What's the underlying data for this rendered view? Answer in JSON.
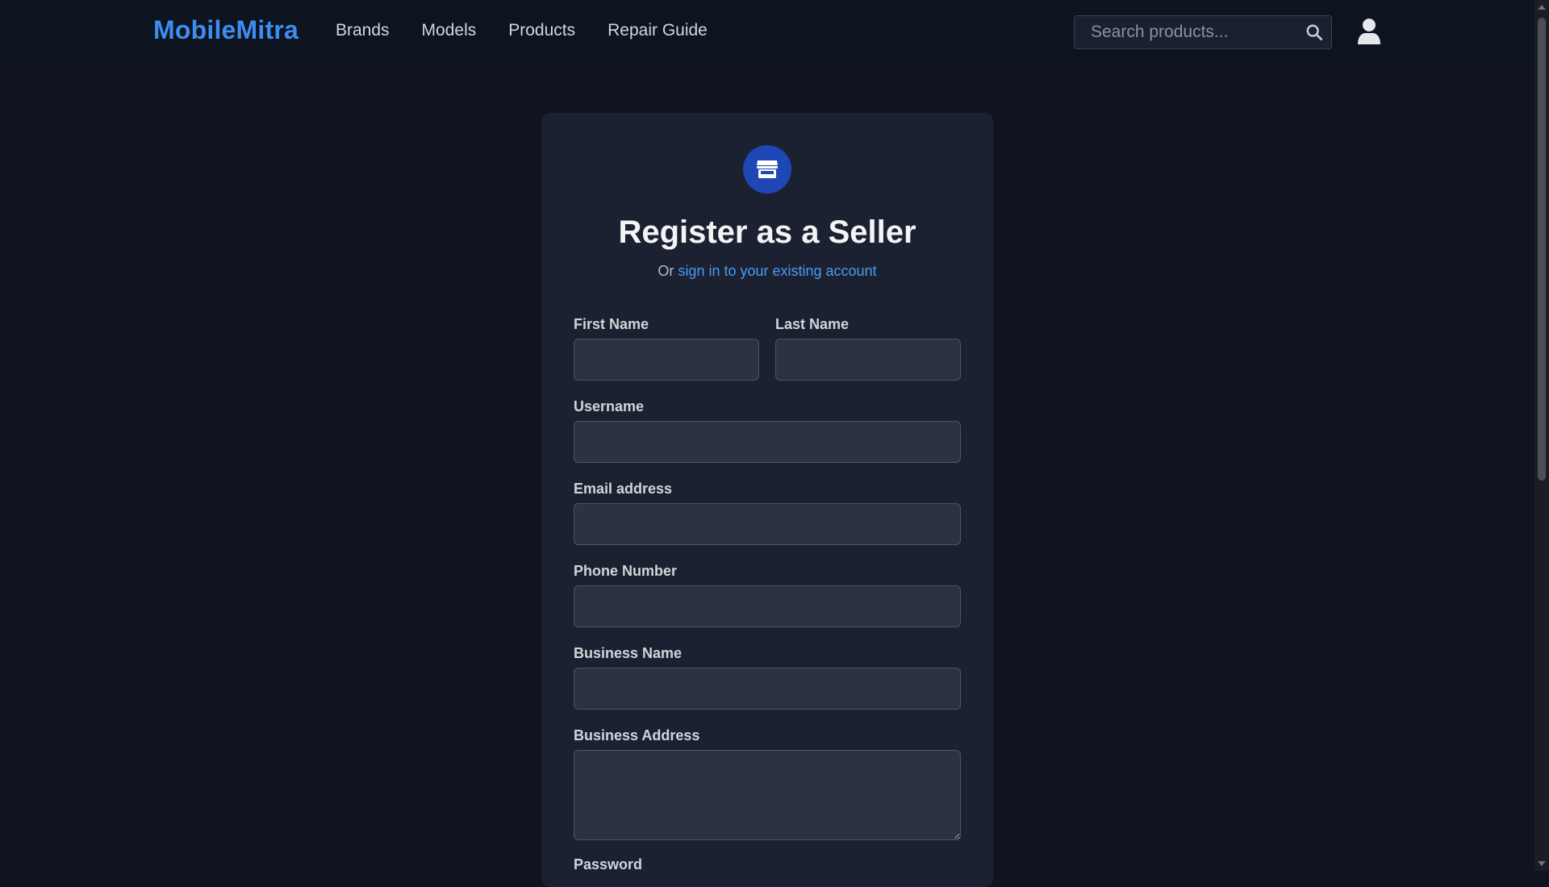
{
  "header": {
    "logo": "MobileMitra",
    "nav": [
      "Brands",
      "Models",
      "Products",
      "Repair Guide"
    ],
    "search_placeholder": "Search products..."
  },
  "form": {
    "title": "Register as a Seller",
    "subtitle_prefix": "Or",
    "signin_link": "sign in to your existing account",
    "fields": {
      "first_name": "First Name",
      "last_name": "Last Name",
      "username": "Username",
      "email": "Email address",
      "phone": "Phone Number",
      "business_name": "Business Name",
      "business_address": "Business Address",
      "password": "Password"
    }
  },
  "colors": {
    "background": "#0f1420",
    "card": "#1b2130",
    "accent": "#3b8ef0",
    "badge": "#1e47b5",
    "input": "#2b3240"
  }
}
